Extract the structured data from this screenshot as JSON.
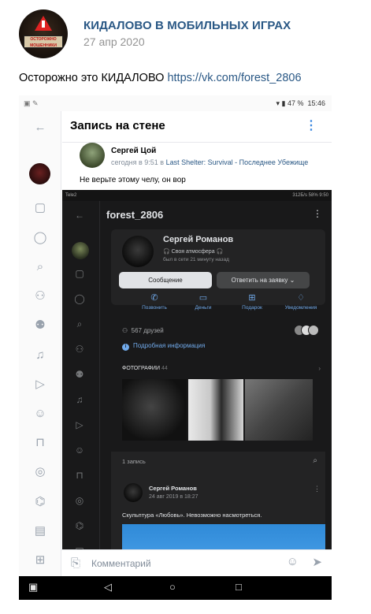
{
  "post": {
    "channel_name": "КИДАЛОВО В МОБИЛЬНЫХ ИГРАХ",
    "date": "27 апр 2020",
    "avatar_text": "ОСТОРОЖНО МОШЕННИКИ",
    "text": "Осторожно это КИДАЛОВО ",
    "link": "https://vk.com/forest_2806"
  },
  "shot": {
    "statusbar": {
      "battery": "47 %",
      "time": "15:46"
    },
    "wall_title": "Запись на стене",
    "author": {
      "name": "Сергей Цой",
      "meta_prefix": "сегодня в 9:51 в ",
      "meta_link": "Last Shelter: Survival - Последнее Убежище"
    },
    "inner_text": "Не верьте этому челу, он вор",
    "dark": {
      "status_left": "Tele2",
      "status_right": "312Б/s 58% 9:50",
      "title": "forest_2806",
      "profile": {
        "name": "Сергей Романов",
        "status": "Своя атмосфера",
        "seen": "был в сети 21 минуту назад"
      },
      "btn_message": "Сообщение",
      "btn_request": "Ответить на заявку",
      "actions": [
        "Позвонить",
        "Деньги",
        "Подарок",
        "Уведомления"
      ],
      "friends": "567 друзей",
      "info": "Подробная информация",
      "photos_label": "ФОТОГРАФИИ",
      "photos_count": "44",
      "records": "1 запись",
      "post_author": "Сергей Романов",
      "post_date": "24 авг 2019 в 18:27",
      "post_text": "Скульптура «Любовь». Невозможно насмотреться."
    },
    "comment_placeholder": "Комментарий"
  }
}
